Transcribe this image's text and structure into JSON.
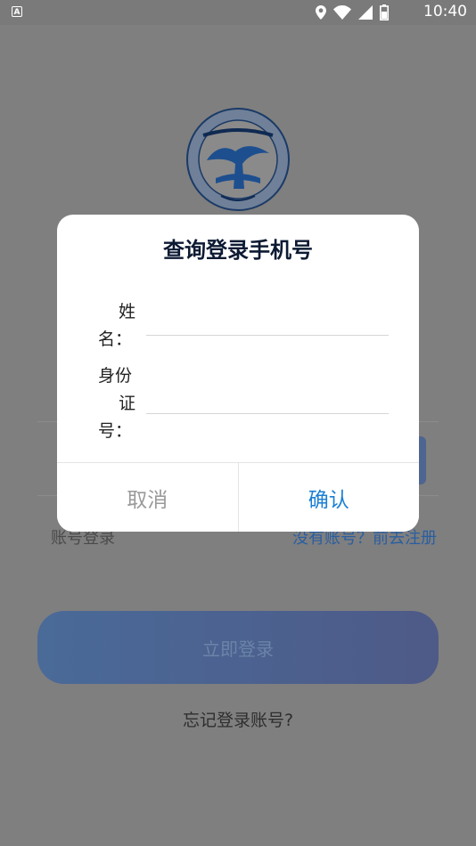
{
  "status_bar": {
    "app_badge": "A",
    "time": "10:40"
  },
  "background": {
    "account_login_label": "账号登录",
    "register_link": "没有账号？前去注册",
    "login_button": "立即登录",
    "forgot_link": "忘记登录账号?"
  },
  "dialog": {
    "title": "查询登录手机号",
    "name_label_line1": "姓",
    "name_label_line2": "名：",
    "id_label_line1": "身份",
    "id_label_line2": "证",
    "id_label_line3": "号：",
    "name_value": "",
    "id_value": "",
    "cancel_label": "取消",
    "confirm_label": "确认"
  },
  "colors": {
    "accent": "#1a7fd4",
    "overlay": "#808080",
    "title": "#0d1a33"
  },
  "icons": [
    "location-icon",
    "wifi-icon",
    "signal-icon",
    "battery-icon",
    "college-logo-icon"
  ]
}
